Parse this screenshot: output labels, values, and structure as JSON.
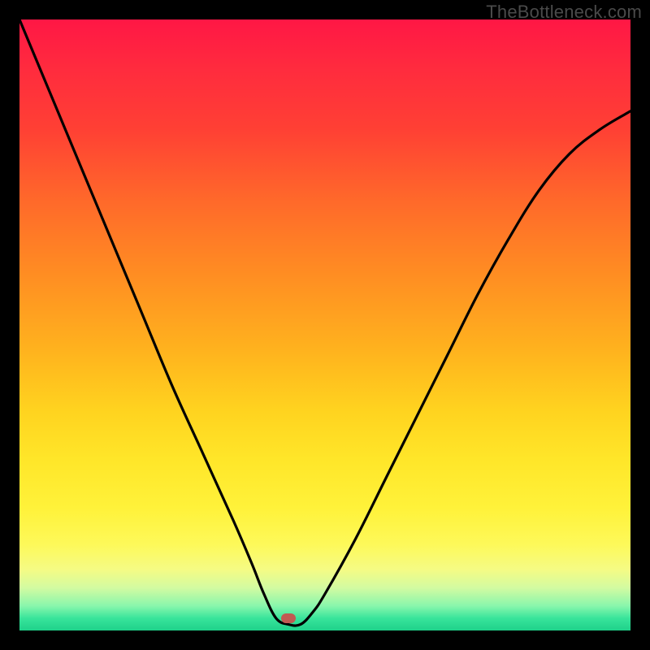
{
  "watermark": "TheBottleneck.com",
  "colors": {
    "frame": "#000000",
    "curve": "#000000",
    "marker": "#c15a52",
    "gradient_top": "#ff1745",
    "gradient_bottom": "#1fd18a"
  },
  "chart_data": {
    "type": "line",
    "title": "",
    "xlabel": "",
    "ylabel": "",
    "xlim": [
      0,
      100
    ],
    "ylim": [
      0,
      100
    ],
    "annotations": [
      {
        "name": "marker",
        "x": 44,
        "y": 2
      }
    ],
    "series": [
      {
        "name": "curve",
        "x": [
          0,
          5,
          10,
          15,
          20,
          25,
          30,
          35,
          38,
          40,
          42,
          44,
          46,
          48,
          50,
          55,
          60,
          65,
          70,
          75,
          80,
          85,
          90,
          95,
          100
        ],
        "values": [
          100,
          88,
          76,
          64,
          52,
          40,
          29,
          18,
          11,
          6,
          2,
          1,
          1,
          3,
          6,
          15,
          25,
          35,
          45,
          55,
          64,
          72,
          78,
          82,
          85
        ]
      }
    ]
  }
}
